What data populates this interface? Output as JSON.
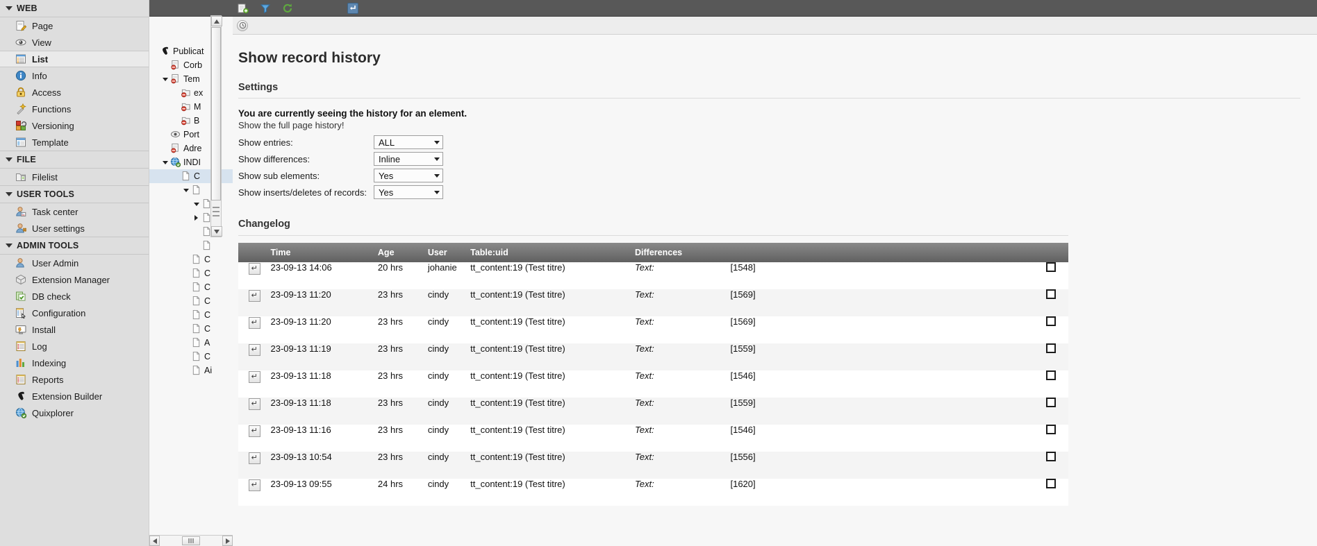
{
  "sidebar": {
    "sections": [
      {
        "title": "WEB",
        "items": [
          {
            "label": "Page",
            "icon": "page-icon"
          },
          {
            "label": "View",
            "icon": "eye-icon"
          },
          {
            "label": "List",
            "icon": "list-icon",
            "active": true
          },
          {
            "label": "Info",
            "icon": "info-icon"
          },
          {
            "label": "Access",
            "icon": "lock-icon"
          },
          {
            "label": "Functions",
            "icon": "wand-icon"
          },
          {
            "label": "Versioning",
            "icon": "versioning-icon"
          },
          {
            "label": "Template",
            "icon": "template-icon"
          }
        ]
      },
      {
        "title": "FILE",
        "items": [
          {
            "label": "Filelist",
            "icon": "folder-icon"
          }
        ]
      },
      {
        "title": "USER TOOLS",
        "items": [
          {
            "label": "Task center",
            "icon": "task-center-icon"
          },
          {
            "label": "User settings",
            "icon": "user-settings-icon"
          }
        ]
      },
      {
        "title": "ADMIN TOOLS",
        "items": [
          {
            "label": "User Admin",
            "icon": "user-admin-icon"
          },
          {
            "label": "Extension Manager",
            "icon": "package-icon"
          },
          {
            "label": "DB check",
            "icon": "db-check-icon"
          },
          {
            "label": "Configuration",
            "icon": "configuration-icon"
          },
          {
            "label": "Install",
            "icon": "install-icon"
          },
          {
            "label": "Log",
            "icon": "log-icon"
          },
          {
            "label": "Indexing",
            "icon": "indexing-icon"
          },
          {
            "label": "Reports",
            "icon": "reports-icon"
          },
          {
            "label": "Extension Builder",
            "icon": "typo3-icon"
          },
          {
            "label": "Quixplorer",
            "icon": "globe-icon"
          }
        ]
      }
    ]
  },
  "tree": {
    "nodes": [
      {
        "label": "Publicat",
        "indent": 0,
        "icon": "typo3-icon",
        "toggle": "none"
      },
      {
        "label": "Corb",
        "indent": 1,
        "icon": "page-red-icon",
        "toggle": "none"
      },
      {
        "label": "Tem",
        "indent": 1,
        "icon": "page-red-icon",
        "toggle": "down"
      },
      {
        "label": "ex",
        "indent": 2,
        "icon": "folder-red-icon",
        "toggle": "none"
      },
      {
        "label": "M",
        "indent": 2,
        "icon": "folder-red-icon",
        "toggle": "none"
      },
      {
        "label": "B",
        "indent": 2,
        "icon": "folder-red-icon",
        "toggle": "none"
      },
      {
        "label": "Port",
        "indent": 1,
        "icon": "link-icon",
        "toggle": "none"
      },
      {
        "label": "Adre",
        "indent": 1,
        "icon": "page-red-icon",
        "toggle": "none"
      },
      {
        "label": "INDI",
        "indent": 1,
        "icon": "globe-icon",
        "toggle": "down"
      },
      {
        "label": "C",
        "indent": 2,
        "icon": "doc-icon",
        "toggle": "none",
        "selected": true
      },
      {
        "label": "",
        "indent": 3,
        "icon": "doc-icon",
        "toggle": "down"
      },
      {
        "label": "",
        "indent": 4,
        "icon": "doc-icon",
        "toggle": "down"
      },
      {
        "label": "",
        "indent": 4,
        "icon": "doc-icon",
        "toggle": "right"
      },
      {
        "label": "",
        "indent": 4,
        "icon": "doc-icon",
        "toggle": "none"
      },
      {
        "label": "",
        "indent": 4,
        "icon": "doc-icon",
        "toggle": "none"
      },
      {
        "label": "C",
        "indent": 3,
        "icon": "doc-icon",
        "toggle": "none"
      },
      {
        "label": "C",
        "indent": 3,
        "icon": "doc-icon",
        "toggle": "none"
      },
      {
        "label": "C",
        "indent": 3,
        "icon": "doc-icon",
        "toggle": "none"
      },
      {
        "label": "C",
        "indent": 3,
        "icon": "doc-icon",
        "toggle": "none"
      },
      {
        "label": "C",
        "indent": 3,
        "icon": "doc-icon",
        "toggle": "none"
      },
      {
        "label": "C",
        "indent": 3,
        "icon": "doc-icon",
        "toggle": "none"
      },
      {
        "label": "A",
        "indent": 3,
        "icon": "doc-icon",
        "toggle": "none"
      },
      {
        "label": "C",
        "indent": 3,
        "icon": "doc-icon",
        "toggle": "none"
      },
      {
        "label": "Ai",
        "indent": 3,
        "icon": "doc-icon",
        "toggle": "none"
      }
    ]
  },
  "toolbar": {
    "new_record_icon": "new-record-icon",
    "filter_icon": "filter-icon",
    "refresh_icon": "refresh-icon",
    "back_icon": "back-arrow-icon",
    "history_icon": "history-icon"
  },
  "main": {
    "page_title": "Show record history",
    "settings_heading": "Settings",
    "notice": "You are currently seeing the history for an element.",
    "full_page_link": "Show the full page history!",
    "form": [
      {
        "label": "Show entries:",
        "value": "ALL",
        "name": "show-entries"
      },
      {
        "label": "Show differences:",
        "value": "Inline",
        "name": "show-differences"
      },
      {
        "label": "Show sub elements:",
        "value": "Yes",
        "name": "show-sub-elements"
      },
      {
        "label": "Show inserts/deletes of records:",
        "value": "Yes",
        "name": "show-inserts-deletes"
      }
    ],
    "changelog_heading": "Changelog",
    "table": {
      "columns": [
        "",
        "Time",
        "Age",
        "User",
        "Table:uid",
        "Differences",
        "",
        ""
      ],
      "rows": [
        {
          "time": "23-09-13 14:06",
          "age": "20 hrs",
          "user": "johanie",
          "table_uid": "tt_content:19 (Test titre)",
          "diff_label": "Text:",
          "diff_value": "[1548]"
        },
        {
          "time": "23-09-13 11:20",
          "age": "23 hrs",
          "user": "cindy",
          "table_uid": "tt_content:19 (Test titre)",
          "diff_label": "Text:",
          "diff_value": "[1569]"
        },
        {
          "time": "23-09-13 11:20",
          "age": "23 hrs",
          "user": "cindy",
          "table_uid": "tt_content:19 (Test titre)",
          "diff_label": "Text:",
          "diff_value": "[1569]"
        },
        {
          "time": "23-09-13 11:19",
          "age": "23 hrs",
          "user": "cindy",
          "table_uid": "tt_content:19 (Test titre)",
          "diff_label": "Text:",
          "diff_value": "[1559]"
        },
        {
          "time": "23-09-13 11:18",
          "age": "23 hrs",
          "user": "cindy",
          "table_uid": "tt_content:19 (Test titre)",
          "diff_label": "Text:",
          "diff_value": "[1546]"
        },
        {
          "time": "23-09-13 11:18",
          "age": "23 hrs",
          "user": "cindy",
          "table_uid": "tt_content:19 (Test titre)",
          "diff_label": "Text:",
          "diff_value": "[1559]"
        },
        {
          "time": "23-09-13 11:16",
          "age": "23 hrs",
          "user": "cindy",
          "table_uid": "tt_content:19 (Test titre)",
          "diff_label": "Text:",
          "diff_value": "[1546]"
        },
        {
          "time": "23-09-13 10:54",
          "age": "23 hrs",
          "user": "cindy",
          "table_uid": "tt_content:19 (Test titre)",
          "diff_label": "Text:",
          "diff_value": "[1556]"
        },
        {
          "time": "23-09-13 09:55",
          "age": "24 hrs",
          "user": "cindy",
          "table_uid": "tt_content:19 (Test titre)",
          "diff_label": "Text:",
          "diff_value": "[1620]"
        }
      ]
    }
  },
  "colors": {
    "sidebar_bg": "#dedede",
    "toolbar_bg": "#585858",
    "table_header": "#6e6e6e",
    "accent_orange": "#f5a623"
  }
}
